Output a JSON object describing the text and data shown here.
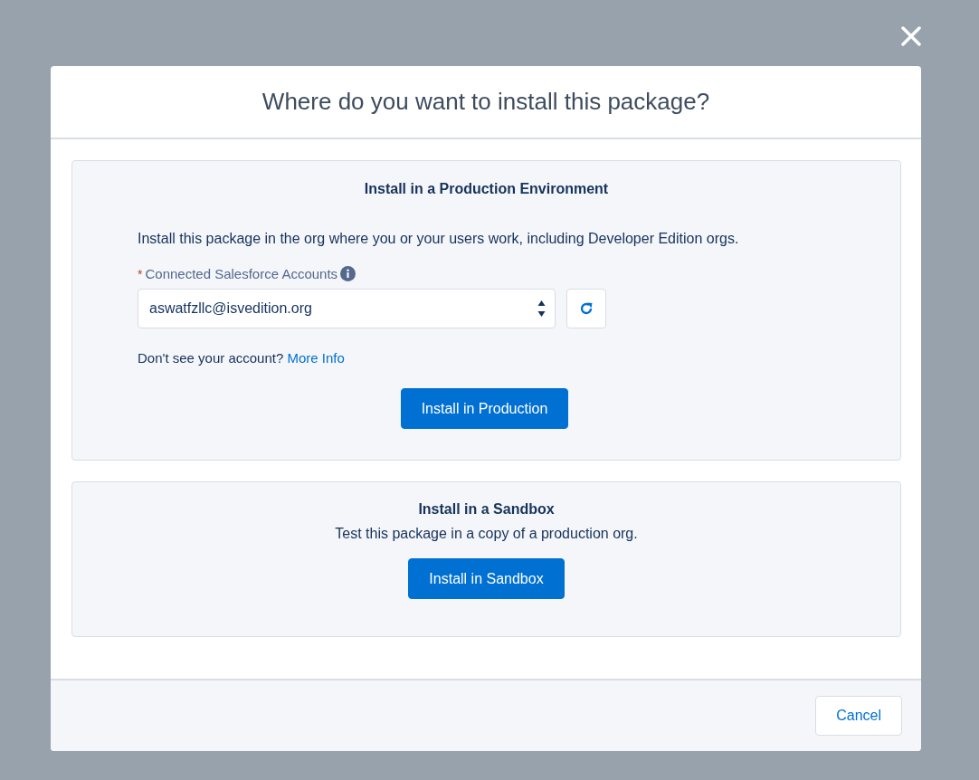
{
  "dialog": {
    "title": "Where do you want to install this package?"
  },
  "production": {
    "heading": "Install in a Production Environment",
    "description": "Install this package in the org where you or your users work, including Developer Edition orgs.",
    "field": {
      "required_mark": "*",
      "label": "Connected Salesforce Accounts",
      "value": "aswatfzllc@isvedition.org"
    },
    "help_text": "Don't see your account?",
    "help_link": "More Info",
    "button": "Install in Production"
  },
  "sandbox": {
    "heading": "Install in a Sandbox",
    "description": "Test this package in a copy of a production org.",
    "button": "Install in Sandbox"
  },
  "footer": {
    "cancel": "Cancel"
  }
}
